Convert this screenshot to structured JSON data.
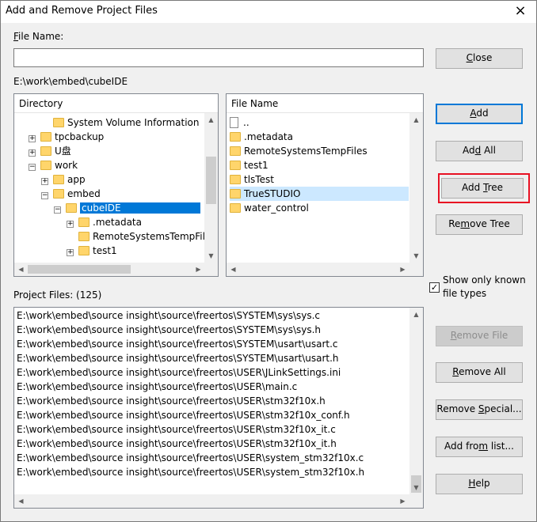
{
  "dialog": {
    "title": "Add and Remove Project Files",
    "file_name_label": "File Name:",
    "file_name_value": "",
    "current_path": "E:\\work\\embed\\cubeIDE",
    "project_files_label": "Project Files: (125)",
    "show_known_label_line1": "Show only known",
    "show_known_label_line2": "file types",
    "show_known_checked": true
  },
  "icons": {
    "close": "×",
    "checkbox_mark": "✓",
    "up_arrow": "▲",
    "down_arrow": "▼",
    "left_arrow": "◀",
    "right_arrow": "▶",
    "expand": "+",
    "collapse": "−"
  },
  "directory": {
    "header": "Directory",
    "items": [
      {
        "label": "System Volume Information",
        "expander": ""
      },
      {
        "label": "tpcbackup",
        "expander": "+"
      },
      {
        "label": "U盘",
        "expander": "+"
      },
      {
        "label": "work",
        "expander": "−"
      },
      {
        "label": "app",
        "expander": "+"
      },
      {
        "label": "embed",
        "expander": "−"
      },
      {
        "label": "cubeIDE",
        "expander": "−"
      },
      {
        "label": ".metadata",
        "expander": "+"
      },
      {
        "label": "RemoteSystemsTempFile",
        "expander": ""
      },
      {
        "label": "test1",
        "expander": "+"
      }
    ]
  },
  "file_list": {
    "header": "File Name",
    "items": [
      "..",
      ".metadata",
      "RemoteSystemsTempFiles",
      "test1",
      "tlsTest",
      "TrueSTUDIO",
      "water_control"
    ]
  },
  "project_files": [
    "E:\\work\\embed\\source insight\\source\\freertos\\SYSTEM\\sys\\sys.c",
    "E:\\work\\embed\\source insight\\source\\freertos\\SYSTEM\\sys\\sys.h",
    "E:\\work\\embed\\source insight\\source\\freertos\\SYSTEM\\usart\\usart.c",
    "E:\\work\\embed\\source insight\\source\\freertos\\SYSTEM\\usart\\usart.h",
    "E:\\work\\embed\\source insight\\source\\freertos\\USER\\JLinkSettings.ini",
    "E:\\work\\embed\\source insight\\source\\freertos\\USER\\main.c",
    "E:\\work\\embed\\source insight\\source\\freertos\\USER\\stm32f10x.h",
    "E:\\work\\embed\\source insight\\source\\freertos\\USER\\stm32f10x_conf.h",
    "E:\\work\\embed\\source insight\\source\\freertos\\USER\\stm32f10x_it.c",
    "E:\\work\\embed\\source insight\\source\\freertos\\USER\\stm32f10x_it.h",
    "E:\\work\\embed\\source insight\\source\\freertos\\USER\\system_stm32f10x.c",
    "E:\\work\\embed\\source insight\\source\\freertos\\USER\\system_stm32f10x.h"
  ],
  "buttons": {
    "close": {
      "pre": "",
      "u": "C",
      "post": "lose"
    },
    "add": {
      "pre": "",
      "u": "A",
      "post": "dd"
    },
    "add_all": {
      "pre": "Ad",
      "u": "d",
      "post": " All"
    },
    "add_tree": {
      "pre": "Add ",
      "u": "T",
      "post": "ree"
    },
    "remove_tree": {
      "pre": "Re",
      "u": "m",
      "post": "ove Tree"
    },
    "remove_file": {
      "pre": "",
      "u": "R",
      "post": "emove File"
    },
    "remove_all": {
      "pre": "",
      "u": "R",
      "post": "emove All"
    },
    "remove_special": {
      "pre": "Remove ",
      "u": "S",
      "post": "pecial..."
    },
    "add_from_list": {
      "pre": "Add fro",
      "u": "m",
      "post": " list..."
    },
    "help": {
      "pre": "",
      "u": "H",
      "post": "elp"
    }
  },
  "colors": {
    "selection": "#0078d7",
    "hover_row": "#cce8ff",
    "annotation_red": "#e81123"
  }
}
